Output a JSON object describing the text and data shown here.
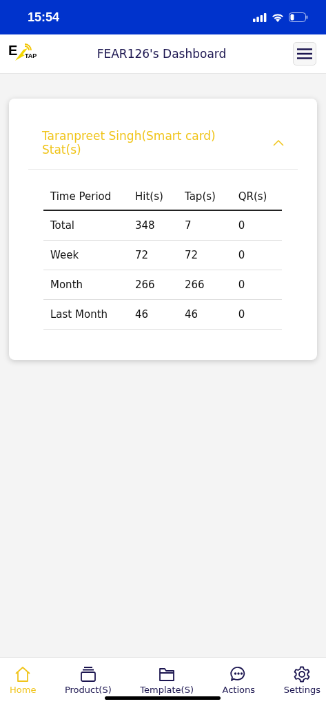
{
  "status_bar": {
    "time": "15:54"
  },
  "header": {
    "logo": {
      "letter": "E",
      "sub": "TAP"
    },
    "title": "FEAR126's Dashboard"
  },
  "panel": {
    "title": "Taranpreet Singh(Smart card) Stat(s)",
    "expanded": true,
    "table": {
      "columns": [
        "Time Period",
        "Hit(s)",
        "Tap(s)",
        "QR(s)"
      ],
      "rows": [
        [
          "Total",
          "348",
          "7",
          "0"
        ],
        [
          "Week",
          "72",
          "72",
          "0"
        ],
        [
          "Month",
          "266",
          "266",
          "0"
        ],
        [
          "Last Month",
          "46",
          "46",
          "0"
        ]
      ]
    }
  },
  "nav": [
    {
      "label": "Home",
      "kind": "home",
      "selected": true
    },
    {
      "label": "Product(S)",
      "kind": "stack",
      "selected": false
    },
    {
      "label": "Template(S)",
      "kind": "folder",
      "selected": false
    },
    {
      "label": "Actions",
      "kind": "chat",
      "selected": false
    },
    {
      "label": "Settings",
      "kind": "gear",
      "selected": false
    }
  ]
}
